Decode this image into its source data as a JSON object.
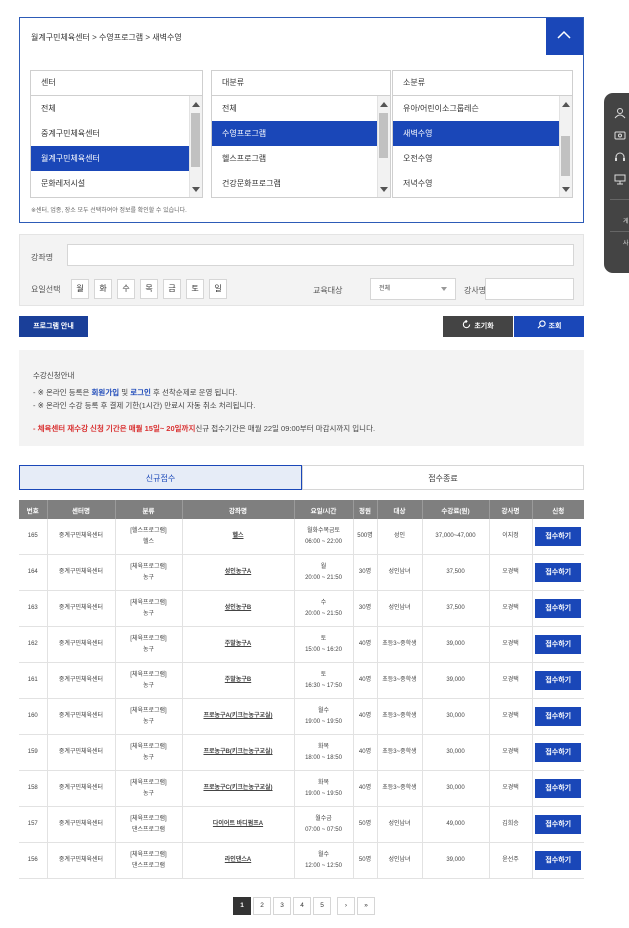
{
  "breadcrumb": "월계구민체육센터 > 수영프로그램 > 새벽수영",
  "note": "※센터, 업종, 장소 모두 선택하여야 정보를 확인할 수 있습니다.",
  "columns": [
    {
      "header": "센터",
      "items": [
        "전체",
        "중계구민체육센터",
        "월계구민체육센터",
        "문화레저시설"
      ],
      "selected": 2
    },
    {
      "header": "대분류",
      "items": [
        "전체",
        "수영프로그램",
        "헬스프로그램",
        "건강문화프로그램"
      ],
      "selected": 1
    },
    {
      "header": "소분류",
      "items": [
        "유아/어린이소그룹레슨",
        "새벽수영",
        "오전수영",
        "저녁수영"
      ],
      "selected": 1
    }
  ],
  "search": {
    "course_label": "강좌명",
    "days_label": "요일선택",
    "days": [
      "월",
      "화",
      "수",
      "목",
      "금",
      "토",
      "일"
    ],
    "target_label": "교육대상",
    "target_value": "전체",
    "teacher_label": "강사명"
  },
  "buttons": {
    "program_guide": "프로그램 안내",
    "reset": "초기화",
    "search": "조회"
  },
  "info": {
    "title": "수강신청안내",
    "line1_a": "- ※ 온라인 등록은 ",
    "line1_b": "회원가입",
    "line1_c": " 및 ",
    "line1_d": "로그인",
    "line1_e": " 후 선착순제로 운영 됩니다.",
    "line2": "- ※ 온라인 수강 등록 후 결제 기한(1시간) 만료시 자동 취소 처리됩니다.",
    "line3_red": "- 체육센터 재수강 신청 기간은 매월 15일~ 20일까지",
    "line3_rest": "신규 접수기간은 매월 22일 09:00부터 마감시까지 입니다."
  },
  "tabs": [
    "신규접수",
    "접수종료"
  ],
  "table": {
    "headers": [
      "번호",
      "센터명",
      "분류",
      "강좌명",
      "요일/시간",
      "정원",
      "대상",
      "수강료(원)",
      "강사명",
      "신청"
    ],
    "apply_label": "접수하기",
    "rows": [
      {
        "no": "165",
        "center": "중계구민체육센터",
        "cat1": "[헬스프로그램]",
        "cat2": "헬스",
        "name": "헬스",
        "day": "월화수목금토",
        "time": "06:00 ~ 22:00",
        "cap": "500명",
        "target": "성인",
        "fee": "37,000~47,000",
        "teacher": "이지정"
      },
      {
        "no": "164",
        "center": "중계구민체육센터",
        "cat1": "[체육프로그램]",
        "cat2": "농구",
        "name": "성인농구A",
        "day": "월",
        "time": "20:00 ~ 21:50",
        "cap": "30명",
        "target": "성인남녀",
        "fee": "37,500",
        "teacher": "오경택"
      },
      {
        "no": "163",
        "center": "중계구민체육센터",
        "cat1": "[체육프로그램]",
        "cat2": "농구",
        "name": "성인농구B",
        "day": "수",
        "time": "20:00 ~ 21:50",
        "cap": "30명",
        "target": "성인남녀",
        "fee": "37,500",
        "teacher": "오경택"
      },
      {
        "no": "162",
        "center": "중계구민체육센터",
        "cat1": "[체육프로그램]",
        "cat2": "농구",
        "name": "주말농구A",
        "day": "토",
        "time": "15:00 ~ 16:20",
        "cap": "40명",
        "target": "초등3~중학생",
        "fee": "39,000",
        "teacher": "오경택"
      },
      {
        "no": "161",
        "center": "중계구민체육센터",
        "cat1": "[체육프로그램]",
        "cat2": "농구",
        "name": "주말농구B",
        "day": "토",
        "time": "16:30 ~ 17:50",
        "cap": "40명",
        "target": "초등3~중학생",
        "fee": "39,000",
        "teacher": "오경택"
      },
      {
        "no": "160",
        "center": "중계구민체육센터",
        "cat1": "[체육프로그램]",
        "cat2": "농구",
        "name": "프로농구A(키크는농구교실)",
        "day": "월수",
        "time": "19:00 ~ 19:50",
        "cap": "40명",
        "target": "초등3~중학생",
        "fee": "30,000",
        "teacher": "오경택"
      },
      {
        "no": "159",
        "center": "중계구민체육센터",
        "cat1": "[체육프로그램]",
        "cat2": "농구",
        "name": "프로농구B(키크는농구교실)",
        "day": "화목",
        "time": "18:00 ~ 18:50",
        "cap": "40명",
        "target": "초등3~중학생",
        "fee": "30,000",
        "teacher": "오경택"
      },
      {
        "no": "158",
        "center": "중계구민체육센터",
        "cat1": "[체육프로그램]",
        "cat2": "농구",
        "name": "프로농구C(키크는농구교실)",
        "day": "화목",
        "time": "19:00 ~ 19:50",
        "cap": "40명",
        "target": "초등3~중학생",
        "fee": "30,000",
        "teacher": "오경택"
      },
      {
        "no": "157",
        "center": "중계구민체육센터",
        "cat1": "[체육프로그램]",
        "cat2": "댄스프로그램",
        "name": "다이어트 바디펌프A",
        "day": "월수금",
        "time": "07:00 ~ 07:50",
        "cap": "50명",
        "target": "성인남녀",
        "fee": "49,000",
        "teacher": "김희승"
      },
      {
        "no": "156",
        "center": "중계구민체육센터",
        "cat1": "[체육프로그램]",
        "cat2": "댄스프로그램",
        "name": "라인댄스A",
        "day": "월수",
        "time": "12:00 ~ 12:50",
        "cap": "50명",
        "target": "성인남녀",
        "fee": "39,000",
        "teacher": "윤선주"
      }
    ]
  },
  "pagination": {
    "pages": [
      "1",
      "2",
      "3",
      "4",
      "5"
    ],
    "current": "1",
    "next": "›",
    "last": "»"
  },
  "quick_panel": {
    "text1": "게",
    "text2": "사"
  }
}
